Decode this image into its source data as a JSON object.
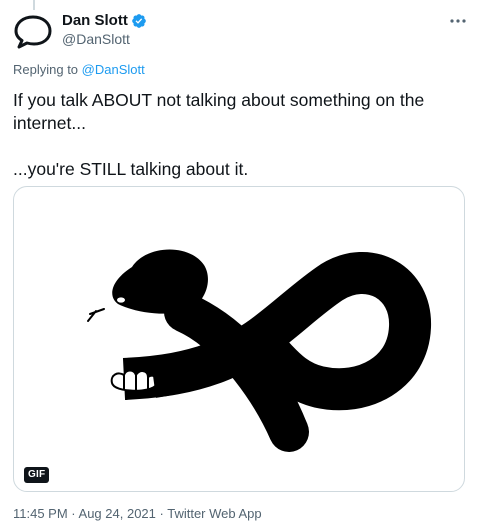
{
  "tweet": {
    "author": {
      "display_name": "Dan Slott",
      "handle": "@DanSlott",
      "avatar_icon": "speech-bubble-icon",
      "verified_icon": "verified-badge-icon"
    },
    "more_icon": "more-options-icon",
    "replying": {
      "prefix": "Replying to",
      "handle": "@DanSlott"
    },
    "text": {
      "line1": "If you talk ABOUT not talking about something on the internet...",
      "line2": "...you're STILL talking about it."
    },
    "media": {
      "type": "gif",
      "badge": "GIF",
      "illustration": "snake-eating-tail-infinity"
    },
    "meta": {
      "time": "11:45 PM",
      "sep1": " · ",
      "date": "Aug 24, 2021",
      "sep2": " · ",
      "source": "Twitter Web App"
    },
    "colors": {
      "text": "#0f1419",
      "secondary": "#536471",
      "link": "#1d9bf0",
      "verified": "#1d9bf0",
      "border": "#cfd9de"
    }
  }
}
